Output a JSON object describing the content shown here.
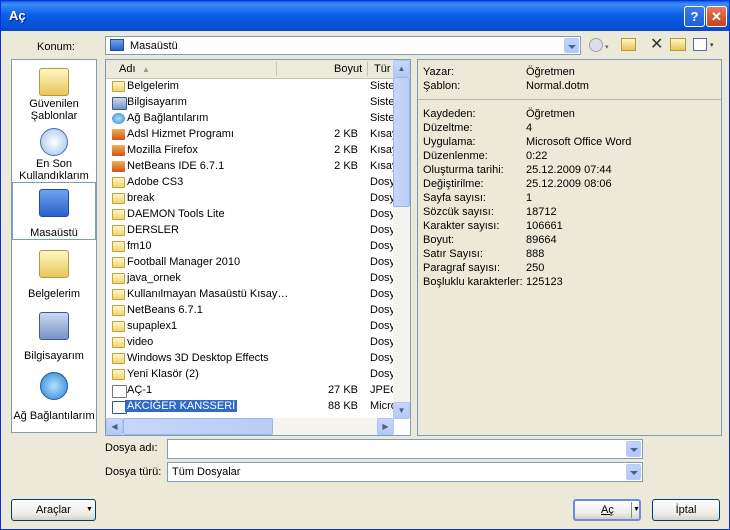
{
  "window": {
    "title": "Aç",
    "help_glyph": "?",
    "close_glyph": "✕"
  },
  "location": {
    "label": "Konum:",
    "value": "Masaüstü"
  },
  "places": [
    {
      "label": "Güvenilen Şablonlar"
    },
    {
      "label": "En Son Kullandıklarım"
    },
    {
      "label": "Masaüstü"
    },
    {
      "label": "Belgelerim"
    },
    {
      "label": "Bilgisayarım"
    },
    {
      "label": "Ağ Bağlantılarım"
    }
  ],
  "columns": {
    "name": "Adı",
    "size": "Boyut",
    "type": "Tür"
  },
  "files": [
    {
      "name": "Belgelerim",
      "size": "",
      "type": "Sistem"
    },
    {
      "name": "Bilgisayarım",
      "size": "",
      "type": "Sistem"
    },
    {
      "name": "Ağ Bağlantılarım",
      "size": "",
      "type": "Sistem"
    },
    {
      "name": "Adsl Hizmet Programı",
      "size": "2 KB",
      "type": "Kısayol"
    },
    {
      "name": "Mozilla Firefox",
      "size": "2 KB",
      "type": "Kısayol"
    },
    {
      "name": "NetBeans IDE 6.7.1",
      "size": "2 KB",
      "type": "Kısayol"
    },
    {
      "name": "Adobe CS3",
      "size": "",
      "type": "Dosya"
    },
    {
      "name": "break",
      "size": "",
      "type": "Dosya"
    },
    {
      "name": "DAEMON Tools Lite",
      "size": "",
      "type": "Dosya"
    },
    {
      "name": "DERSLER",
      "size": "",
      "type": "Dosya"
    },
    {
      "name": "fm10",
      "size": "",
      "type": "Dosya"
    },
    {
      "name": "Football Manager 2010",
      "size": "",
      "type": "Dosya"
    },
    {
      "name": "java_ornek",
      "size": "",
      "type": "Dosya"
    },
    {
      "name": "Kullanılmayan Masaüstü Kısay…",
      "size": "",
      "type": "Dosya"
    },
    {
      "name": "NetBeans 6.7.1",
      "size": "",
      "type": "Dosya"
    },
    {
      "name": "supaplex1",
      "size": "",
      "type": "Dosya"
    },
    {
      "name": "video",
      "size": "",
      "type": "Dosya"
    },
    {
      "name": "Windows 3D Desktop Effects",
      "size": "",
      "type": "Dosya"
    },
    {
      "name": "Yeni Klasör (2)",
      "size": "",
      "type": "Dosya"
    },
    {
      "name": "AÇ-1",
      "size": "27 KB",
      "type": "JPEG"
    },
    {
      "name": "AKCİĞER KANSSERİ",
      "size": "88 KB",
      "type": "Microsoft"
    }
  ],
  "properties": {
    "top": [
      {
        "key": "Yazar:",
        "value": "Öğretmen"
      },
      {
        "key": "Şablon:",
        "value": "Normal.dotm"
      }
    ],
    "details": [
      {
        "key": "Kaydeden:",
        "value": "Öğretmen"
      },
      {
        "key": "Düzeltme:",
        "value": "4"
      },
      {
        "key": "Uygulama:",
        "value": "Microsoft Office Word"
      },
      {
        "key": "Düzenlenme:",
        "value": "0:22"
      },
      {
        "key": "Oluşturma tarihi:",
        "value": "25.12.2009 07:44"
      },
      {
        "key": "Değiştirilme:",
        "value": "25.12.2009 08:06"
      },
      {
        "key": "Sayfa sayısı:",
        "value": "1"
      },
      {
        "key": "Sözcük sayısı:",
        "value": "18712"
      },
      {
        "key": "Karakter sayısı:",
        "value": "106661"
      },
      {
        "key": "Boyut:",
        "value": "89664"
      },
      {
        "key": "Satır Sayısı:",
        "value": "888"
      },
      {
        "key": "Paragraf sayısı:",
        "value": "250"
      },
      {
        "key": "Boşluklu karakterler:",
        "value": "125123"
      }
    ]
  },
  "filename": {
    "label": "Dosya adı:",
    "value": ""
  },
  "filetype": {
    "label": "Dosya türü:",
    "value": "Tüm Dosyalar"
  },
  "buttons": {
    "tools": "Araçlar",
    "open": "Aç",
    "cancel": "İptal"
  }
}
